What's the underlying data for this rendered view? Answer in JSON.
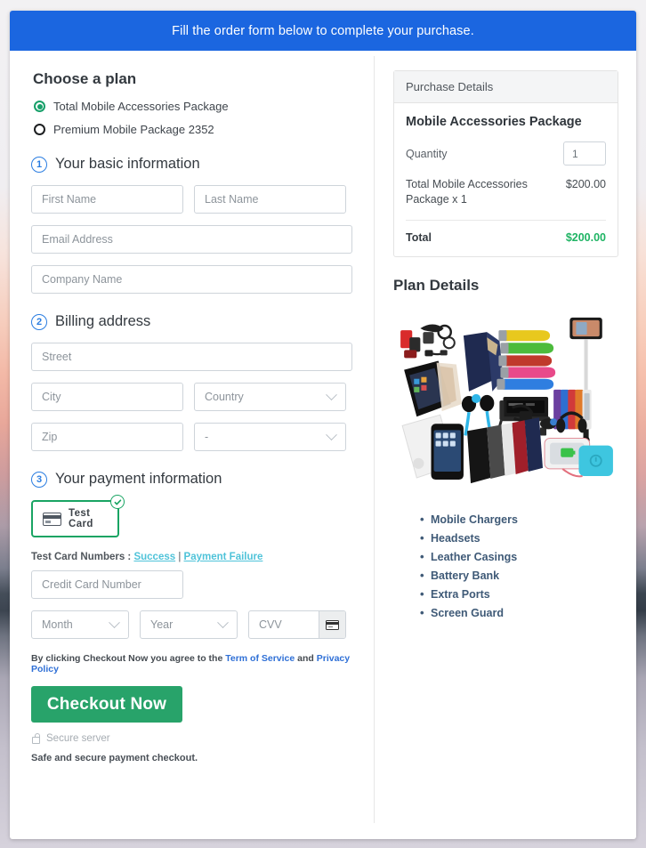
{
  "banner": {
    "text": "Fill the order form below to complete your purchase."
  },
  "plan": {
    "heading": "Choose a plan",
    "options": [
      {
        "label": "Total Mobile Accessories Package",
        "selected": true
      },
      {
        "label": "Premium Mobile Package 2352",
        "selected": false
      }
    ]
  },
  "steps": {
    "basic": {
      "number": "1",
      "title": "Your basic information"
    },
    "billing": {
      "number": "2",
      "title": "Billing address"
    },
    "payment": {
      "number": "3",
      "title": "Your payment information"
    }
  },
  "basic_fields": {
    "first_name": "First Name",
    "last_name": "Last Name",
    "email": "Email Address",
    "company": "Company Name"
  },
  "billing_fields": {
    "street": "Street",
    "city": "City",
    "country": "Country",
    "zip": "Zip",
    "state": "-"
  },
  "payment": {
    "card_tile_label": "Test Card",
    "card_tile_selected": true,
    "test_numbers_prefix": "Test Card Numbers : ",
    "test_numbers_success": "Success",
    "test_numbers_separator": " | ",
    "test_numbers_failure": "Payment Failure",
    "card_number": "Credit Card Number",
    "month": "Month",
    "year": "Year",
    "cvv": "CVV"
  },
  "footer": {
    "terms_prefix": "By clicking Checkout Now you agree to the ",
    "terms_link": "Term of Service",
    "terms_and": " and ",
    "privacy_link": "Privacy Policy",
    "checkout_button": "Checkout Now",
    "secure_server": "Secure server",
    "safe_note": "Safe and secure payment checkout."
  },
  "purchase_details": {
    "panel_title": "Purchase Details",
    "item_title": "Mobile Accessories Package",
    "quantity_label": "Quantity",
    "quantity_value": "1",
    "line_description": "Total Mobile Accessories Package x 1",
    "line_amount": "$200.00",
    "total_label": "Total",
    "total_amount": "$200.00"
  },
  "plan_details": {
    "title": "Plan Details",
    "features": [
      "Mobile Chargers",
      "Headsets",
      "Leather Casings",
      "Battery Bank",
      "Extra Ports",
      "Screen Guard"
    ]
  },
  "colors": {
    "banner_blue": "#1b66e0",
    "accent_green": "#28a36a",
    "total_green": "#1fb464",
    "step_blue": "#2a7de1",
    "link_blue": "#2e6fd6",
    "test_link_cyan": "#4fc3d9"
  }
}
